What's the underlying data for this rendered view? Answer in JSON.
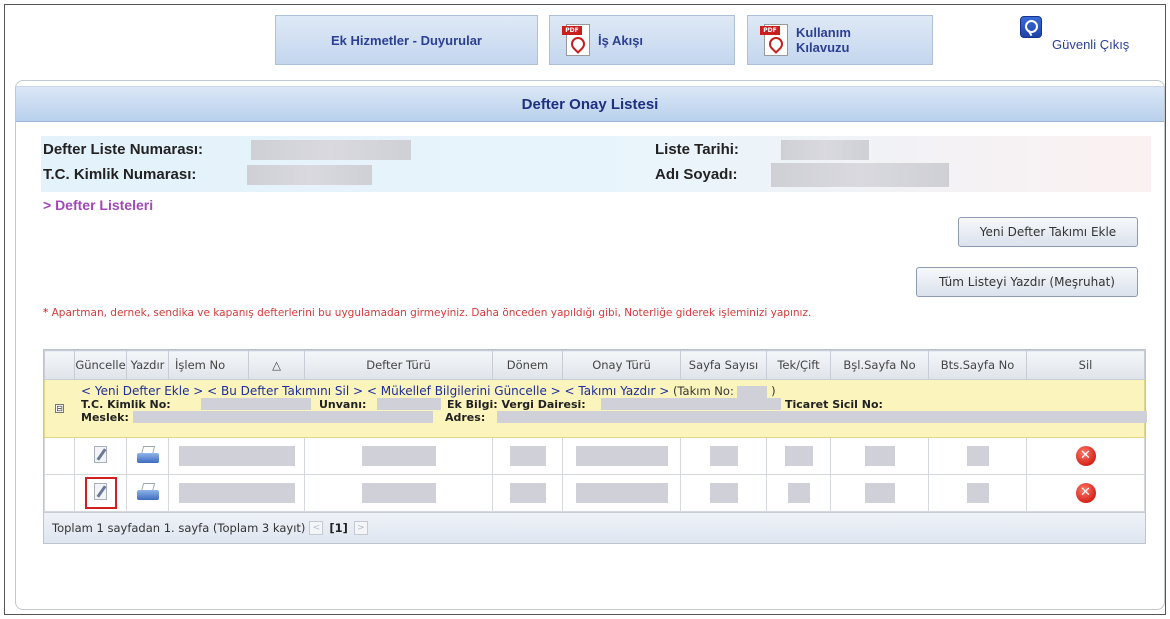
{
  "nav": {
    "ek_hizmetler": "Ek Hizmetler - Duyurular",
    "is_akisi": "İş Akışı",
    "kullanim_line1": "Kullanım",
    "kullanim_line2": "Kılavuzu",
    "pdf_tag": "PDF",
    "logout": "Güvenli Çıkış"
  },
  "panel": {
    "title": "Defter Onay Listesi",
    "defter_liste_label": "Defter Liste Numarası:",
    "liste_tarihi_label": "Liste Tarihi:",
    "tc_kimlik_label": "T.C. Kimlik Numarası:",
    "adi_soyadi_label": "Adı Soyadı:",
    "defter_listeleri_link": "> Defter Listeleri",
    "yeni_takim_button": "Yeni Defter Takımı Ekle",
    "tum_liste_button": "Tüm Listeyi Yazdır (Meşruhat)",
    "warning_star": "*",
    "warning_text": "Apartman, dernek, sendika ve kapanış defterlerini bu uygulamadan girmeyiniz. Daha önceden yapıldığı gibi, Noterliğe giderek işleminizi yapınız."
  },
  "grid": {
    "columns": [
      "Güncelle",
      "Yazdır",
      "İşlem No",
      "△",
      "Defter Türü",
      "Dönem",
      "Onay Türü",
      "Sayfa Sayısı",
      "Tek/Çift",
      "Bşl.Sayfa No",
      "Bts.Sayfa No",
      "Sil"
    ],
    "group": {
      "expander": "⊟",
      "links": "< Yeni Defter Ekle > < Bu Defter Takımını Sil > < Mükellef Bilgilerini Güncelle > < Takımı Yazdır >",
      "takim_prefix": "(Takım No:",
      "takim_suffix": ")",
      "tc_label": "T.C. Kimlik No:",
      "unvan_label": "Unvanı:",
      "ek_bilgi_label": "Ek Bilgi: Vergi Dairesi:",
      "ticaret_label": "Ticaret Sicil No:",
      "meslek_label": "Meslek:",
      "adres_label": "Adres:"
    },
    "pager": {
      "text": "Toplam 1 sayfadan 1. sayfa (Toplam 3 kayıt)",
      "prev": "<",
      "current": "[1]",
      "next": ">"
    }
  }
}
